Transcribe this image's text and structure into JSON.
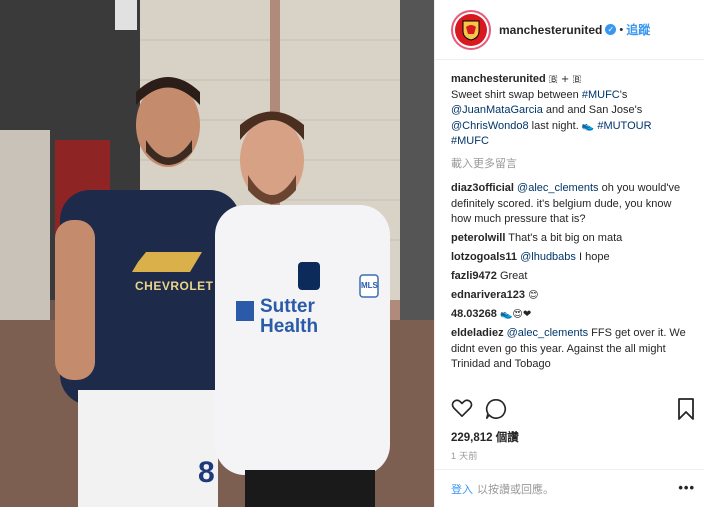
{
  "account": {
    "username": "manchesterunited",
    "follow_label": "追蹤",
    "separator": "•"
  },
  "caption": {
    "username": "manchesterunited",
    "badge": "🇧 + 🇧",
    "t1": "Sweet shirt swap between ",
    "tag1": "#MUFC",
    "t2": "'s ",
    "mention1": "@JuanMataGarcia",
    "t3": " and and San Jose's ",
    "mention2": "@ChrisWondo8",
    "t4": " last night. ",
    "emoji": "👟",
    "tag2": "#MUTOUR",
    "tag3": "#MUFC"
  },
  "load_more": "載入更多留言",
  "comments": [
    {
      "user": "diaz3official",
      "mention": "@alec_clements",
      "text": " oh you would've definitely scored. it's belgium dude, you know how much pressure that is?"
    },
    {
      "user": "peterolwill",
      "mention": "",
      "text": "That's a bit big on mata"
    },
    {
      "user": "lotzogoals11",
      "mention": "@lhudbabs",
      "text": " I hope"
    },
    {
      "user": "fazli9472",
      "mention": "",
      "text": "Great"
    },
    {
      "user": "ednarivera123",
      "mention": "",
      "text": "😊"
    },
    {
      "user": "48.03268",
      "mention": "",
      "text": "👟😍❤"
    },
    {
      "user": "eldeladiez",
      "mention": "@alec_clements",
      "text": " FFS get over it. We didnt even go this year. Against the all might Trinidad and Tobago"
    }
  ],
  "likes": "229,812 個讚",
  "time": "1 天前",
  "footer": {
    "login": "登入",
    "rest": "以按讚或回應。",
    "more": "•••"
  },
  "photo": {
    "left_shirt_sponsor": "CHEVROLET",
    "left_shorts_number": "8",
    "right_shirt_line1": "Sutter",
    "right_shirt_line2": "Health",
    "right_sleeve": "MLS"
  },
  "colors": {
    "accent": "#3897f0",
    "mention": "#003569",
    "muted": "#999999",
    "mu_red": "#d81920"
  },
  "icons": [
    "heart-icon",
    "comment-icon",
    "bookmark-icon",
    "verified-icon",
    "more-options-icon"
  ]
}
